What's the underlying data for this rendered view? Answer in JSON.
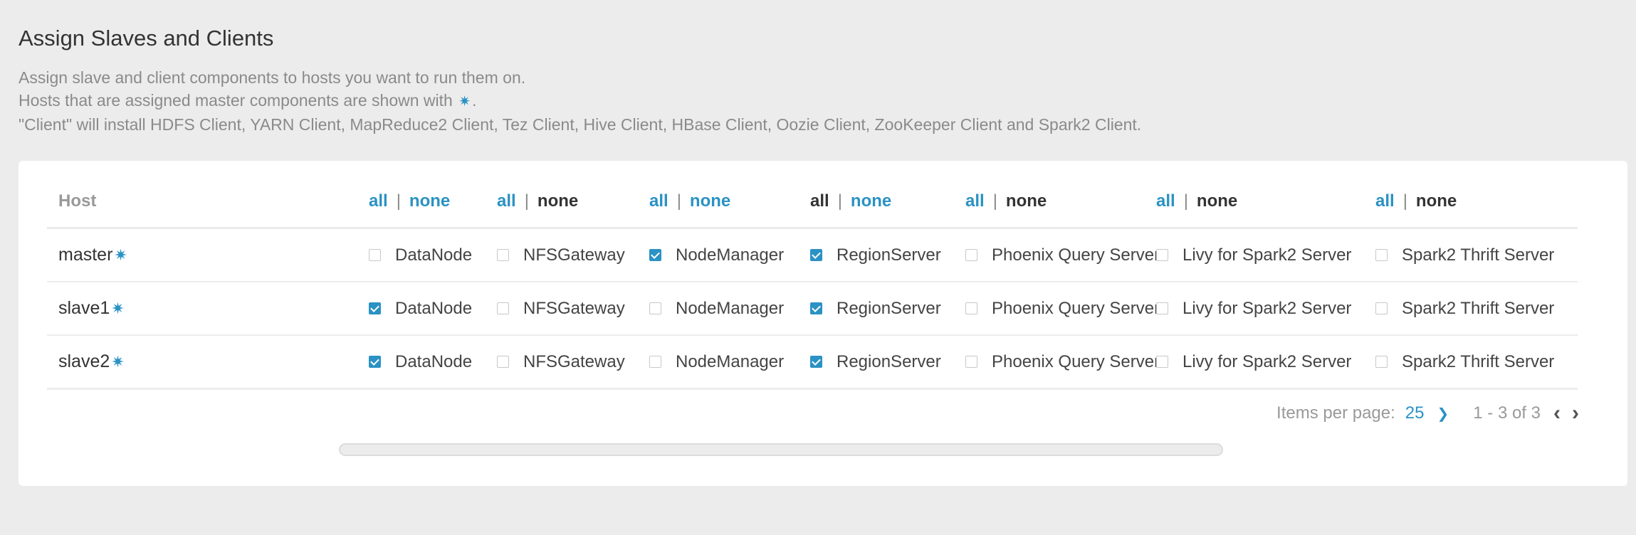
{
  "page": {
    "title": "Assign Slaves and Clients",
    "desc1": "Assign slave and client components to hosts you want to run them on.",
    "desc2_pre": "Hosts that are assigned master components are shown with",
    "desc2_post": ".",
    "desc3": "\"Client\" will install HDFS Client, YARN Client, MapReduce2 Client, Tez Client, Hive Client, HBase Client, Oozie Client, ZooKeeper Client and Spark2 Client.",
    "star_glyph": "✷"
  },
  "table": {
    "host_header": "Host",
    "columns": [
      {
        "all": "all",
        "sep": "|",
        "none": "none",
        "all_link": true,
        "none_link": true,
        "component": "DataNode"
      },
      {
        "all": "all",
        "sep": "|",
        "none": "none",
        "all_link": true,
        "none_link": false,
        "component": "NFSGateway"
      },
      {
        "all": "all",
        "sep": "|",
        "none": "none",
        "all_link": true,
        "none_link": true,
        "component": "NodeManager"
      },
      {
        "all": "all",
        "sep": "|",
        "none": "none",
        "all_link": false,
        "none_link": true,
        "component": "RegionServer"
      },
      {
        "all": "all",
        "sep": "|",
        "none": "none",
        "all_link": true,
        "none_link": false,
        "component": "Phoenix Query Server"
      },
      {
        "all": "all",
        "sep": "|",
        "none": "none",
        "all_link": true,
        "none_link": false,
        "component": "Livy for Spark2 Server"
      },
      {
        "all": "all",
        "sep": "|",
        "none": "none",
        "all_link": true,
        "none_link": false,
        "component": "Spark2 Thrift Server"
      }
    ],
    "rows": [
      {
        "host": "master",
        "checked": [
          false,
          false,
          true,
          true,
          false,
          false,
          false
        ]
      },
      {
        "host": "slave1",
        "checked": [
          true,
          false,
          false,
          true,
          false,
          false,
          false
        ]
      },
      {
        "host": "slave2",
        "checked": [
          true,
          false,
          false,
          true,
          false,
          false,
          false
        ]
      }
    ]
  },
  "pagination": {
    "label": "Items per page:",
    "per_page": "25",
    "range": "1 - 3 of 3"
  },
  "colors": {
    "accent": "#2a92c4",
    "background": "#ececec",
    "card": "#ffffff"
  }
}
